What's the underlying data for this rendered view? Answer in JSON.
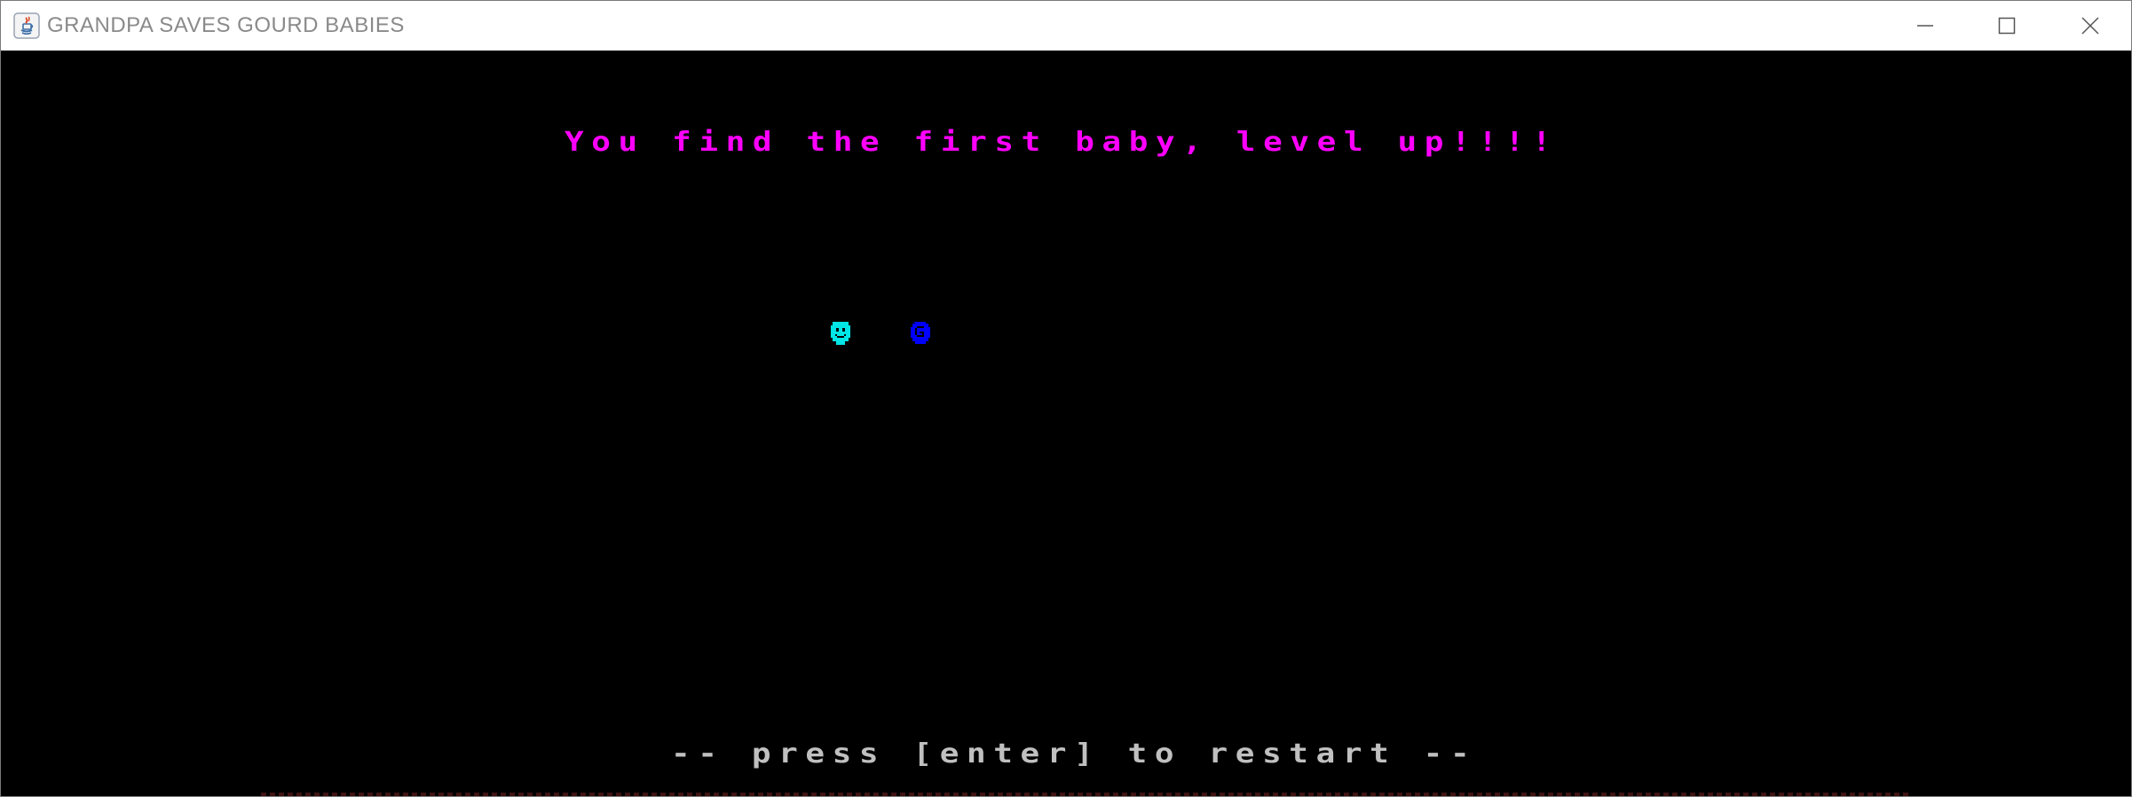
{
  "window": {
    "title": "GRANDPA SAVES GOURD BABIES",
    "icon": "java-app-icon",
    "controls": {
      "minimize_icon": "minimize-icon",
      "maximize_icon": "maximize-icon",
      "close_icon": "close-icon"
    }
  },
  "game": {
    "message": "You find the first baby, level up!!!!",
    "prompt": "-- press [enter] to restart --",
    "colors": {
      "background": "#000000",
      "message": "#ff00ff",
      "prompt": "#c0c0c0",
      "grandpa": "#00e5e5",
      "baby": "#0000ff"
    },
    "sprites": [
      {
        "name": "grandpa",
        "icon": "smiley-face-icon",
        "color": "#00e5e5"
      },
      {
        "name": "baby",
        "icon": "gourd-baby-icon",
        "color": "#0000ff"
      }
    ]
  }
}
